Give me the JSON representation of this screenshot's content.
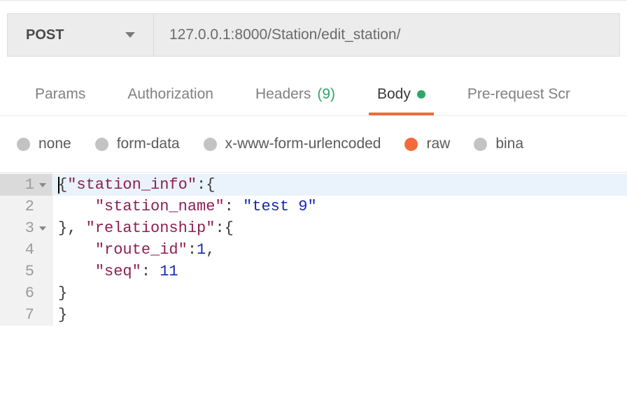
{
  "request": {
    "method": "POST",
    "url": "127.0.0.1:8000/Station/edit_station/"
  },
  "tabs": {
    "params": "Params",
    "authorization": "Authorization",
    "headers": "Headers",
    "headers_count": "(9)",
    "body": "Body",
    "prerequest": "Pre-request Scr"
  },
  "body_types": {
    "none": "none",
    "formdata": "form-data",
    "xwww": "x-www-form-urlencoded",
    "raw": "raw",
    "binary": "bina"
  },
  "editor": {
    "lines": [
      "1",
      "2",
      "3",
      "4",
      "5",
      "6",
      "7"
    ],
    "code": {
      "l1_k1": "\"station_info\"",
      "l2_k1": "\"station_name\"",
      "l2_v1": "\"test 9\"",
      "l3_k1": "\"relationship\"",
      "l4_k1": "\"route_id\"",
      "l4_v1": "1",
      "l5_k1": "\"seq\"",
      "l5_v1": "11"
    }
  }
}
